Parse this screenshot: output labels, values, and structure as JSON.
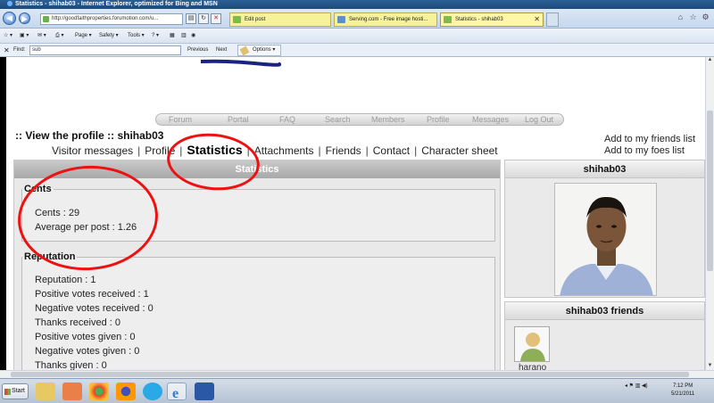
{
  "window": {
    "title": "Statistics - shihab03 - Internet Explorer, optimized for Bing and MSN",
    "address": "http://goodfaithproperties.forumotion.com/u..."
  },
  "tabs": [
    {
      "label": "Edit post"
    },
    {
      "label": "Serving.com - Free image hosti..."
    },
    {
      "label": "Statistics - shihab03"
    }
  ],
  "command_bar": {
    "page": "Page",
    "safety": "Safety",
    "tools": "Tools"
  },
  "find_bar": {
    "label": "Find:",
    "value": "sub",
    "previous": "Previous",
    "next": "Next",
    "options": "Options"
  },
  "forum_menu": [
    "Forum",
    "Portal",
    "FAQ",
    "Search",
    "Members",
    "Profile",
    "Messages",
    "Log Out"
  ],
  "profile": {
    "view_title": ":: View the profile :: shihab03",
    "tabs": [
      "Visitor messages",
      "Profile",
      "Statistics",
      "Attachments",
      "Friends",
      "Contact",
      "Character sheet"
    ],
    "active_tab": "Statistics",
    "add_friends": "Add to my friends list",
    "add_foes": "Add to my foes list"
  },
  "statistics": {
    "header": "Statistics",
    "cents_legend": "Cents",
    "cents": "Cents : 29",
    "average": "Average per post : 1.26",
    "reputation_legend": "Reputation",
    "reputation": "Reputation : 1",
    "pos_received": "Positive votes received : 1",
    "neg_received": "Negative votes received : 0",
    "thanks_received": "Thanks received : 0",
    "pos_given": "Positive votes given : 0",
    "neg_given": "Negative votes given : 0",
    "thanks_given": "Thanks given : 0"
  },
  "sidebar": {
    "username": "shihab03",
    "friends_title": "shihab03 friends",
    "friend_name": "harano"
  },
  "taskbar": {
    "start": "Start",
    "time": "7:12 PM",
    "date": "5/21/2011"
  },
  "colors": {
    "annotation": "#ee1111",
    "panel_header": "#b0b0b0"
  }
}
